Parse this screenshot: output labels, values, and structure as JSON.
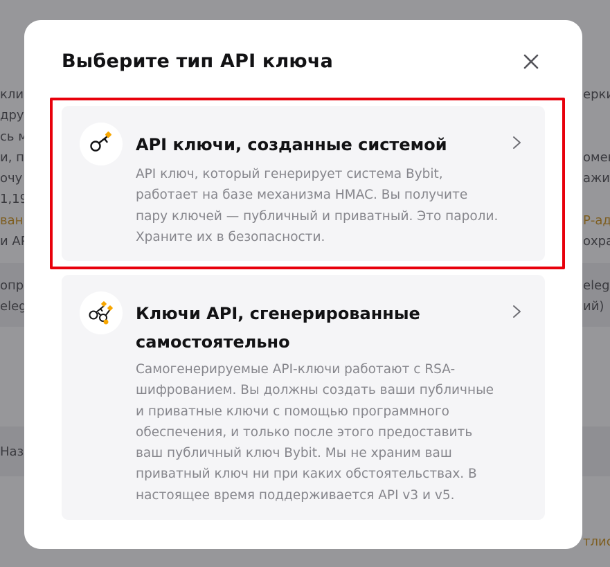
{
  "modal": {
    "title": "Выберите тип API ключа",
    "options": [
      {
        "title": "API ключи, созданные системой",
        "description": "API ключ, который генерирует система Bybit, работает на базе механизма HMAC. Вы получите пару ключей — публичный и приватный. Это пароли. Храните их в безопасности.",
        "icon": "key-icon",
        "highlighted": true
      },
      {
        "title": "Ключи API, сгенерированные самостоятельно",
        "description": "Самогенерируемые API-ключи работают с RSA-шифрованием. Вы должны создать ваши публичные и приватные ключи с помощью программного обеспечения, и только после этого предоставить ваш публичный ключ Bybit. Мы не храним ваш приватный ключ ни при каких обстоятельствах. В настоящее время поддерживается API v3 и v5.",
        "icon": "keys-gear-icon",
        "highlighted": false
      }
    ]
  },
  "background": {
    "fragments_left": [
      "клие",
      "друге",
      "сь м",
      "и, по",
      "очу",
      "1,19",
      "ванн",
      "и АР",
      "опро",
      "elegr",
      "Назв"
    ],
    "fragments_right": [
      "ерки",
      "омен",
      "ажит",
      "Р-адр",
      "охра",
      "eleg",
      "ий)",
      "тлис"
    ]
  },
  "colors": {
    "highlight": "#e8000b",
    "accent": "#f7a600",
    "title": "#121214",
    "description": "#86868c"
  }
}
